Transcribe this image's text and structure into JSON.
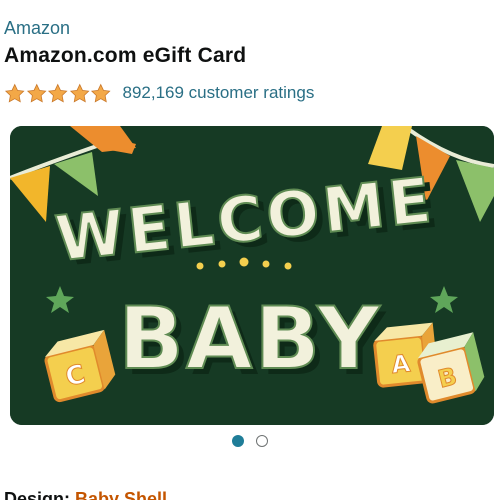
{
  "product": {
    "brand": "Amazon",
    "title": "Amazon.com eGift Card",
    "rating_value": 5,
    "rating_max": 5,
    "ratings_text": "892,169 customer ratings"
  },
  "card_image": {
    "line1": "WELCOME",
    "line2": "BABY",
    "block_left_letter": "C",
    "block_right_a": "A",
    "block_right_b": "B"
  },
  "carousel": {
    "total": 2,
    "active_index": 0
  },
  "design": {
    "label": "Design:",
    "value": "Baby Shell"
  },
  "colors": {
    "link": "#2a6f85",
    "star": "#f3a847",
    "card_bg": "#163a24",
    "dot_active": "#1f7d98",
    "design_value": "#c45500"
  }
}
